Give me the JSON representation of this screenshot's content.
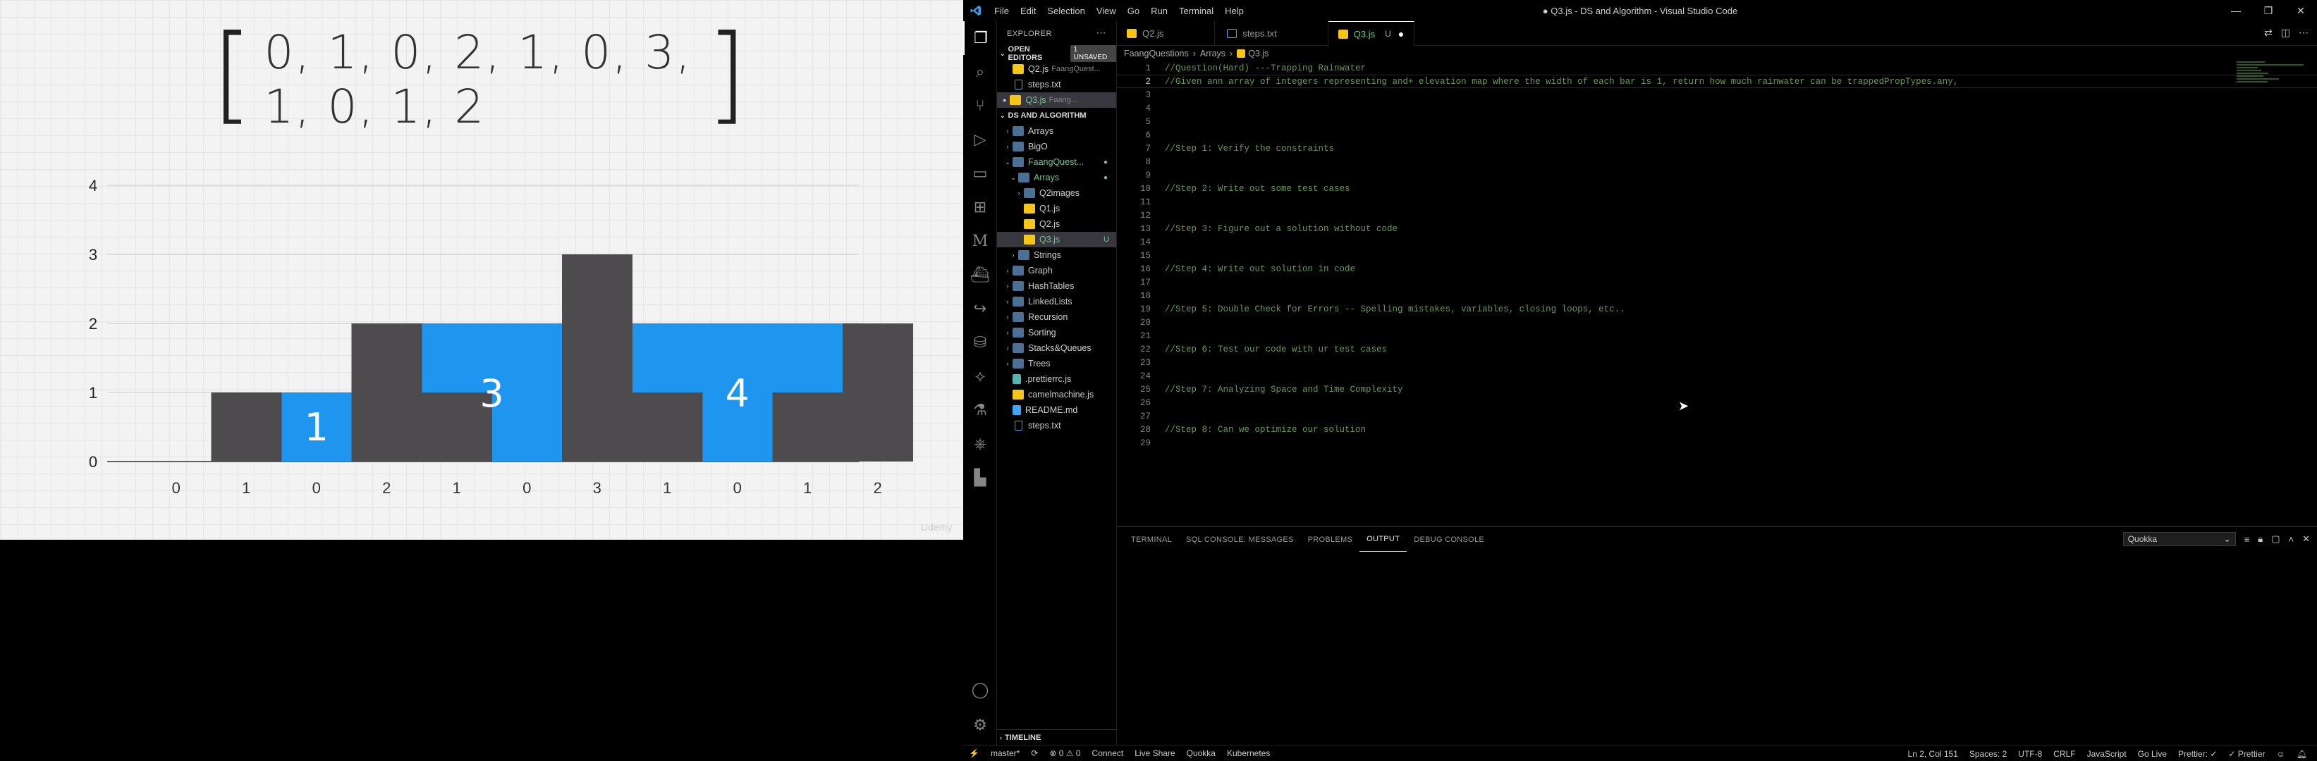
{
  "slide": {
    "bracket_left": "[",
    "bracket_right": "]",
    "array_text": "0, 1, 0, 2, 1, 0, 3, 1, 0, 1, 2",
    "watermark": "Udemy"
  },
  "chart_data": {
    "type": "bar",
    "categories": [
      "0",
      "1",
      "0",
      "2",
      "1",
      "0",
      "3",
      "1",
      "0",
      "1",
      "2"
    ],
    "series": [
      {
        "values": [
          0,
          1,
          0,
          2,
          1,
          0,
          3,
          1,
          0,
          1,
          2
        ]
      }
    ],
    "water": [
      0,
      0,
      1,
      0,
      1,
      2,
      0,
      1,
      2,
      1,
      0
    ],
    "annotations": [
      {
        "text": "1",
        "category_index": 2
      },
      {
        "text": "3",
        "category_index": 4.5
      },
      {
        "text": "4",
        "category_index": 8
      }
    ],
    "yticks": [
      "0",
      "1",
      "2",
      "3",
      "4"
    ],
    "ylim": [
      0,
      4
    ],
    "grid": true,
    "colors": {
      "bar": "#4d4b4e",
      "water": "#1e96f0"
    }
  },
  "vscode": {
    "title": "● Q3.js - DS and Algorithm - Visual Studio Code",
    "menu": [
      "File",
      "Edit",
      "Selection",
      "View",
      "Go",
      "Run",
      "Terminal",
      "Help"
    ],
    "window_controls": [
      "—",
      "❐",
      "✕"
    ],
    "explorer_title": "EXPLORER",
    "open_editors_label": "OPEN EDITORS",
    "unsaved_badge": "1 UNSAVED",
    "open_editors": [
      {
        "name": "Q2.js",
        "hint": "FaangQuest...",
        "icon": "js"
      },
      {
        "name": "steps.txt",
        "hint": "",
        "icon": "txt"
      },
      {
        "name": "Q3.js",
        "hint": "Faang...",
        "icon": "js",
        "badge": "U",
        "modified": "●"
      }
    ],
    "workspace_label": "DS AND ALGORITHM",
    "tree": [
      {
        "name": "Arrays",
        "type": "folder",
        "indent": 1,
        "chev": "›"
      },
      {
        "name": "BigO",
        "type": "folder",
        "indent": 1,
        "chev": "›"
      },
      {
        "name": "FaangQuest...",
        "type": "folder",
        "indent": 1,
        "chev": "⌄",
        "green": true,
        "dot": "●"
      },
      {
        "name": "Arrays",
        "type": "folder",
        "indent": 2,
        "chev": "⌄",
        "green": true,
        "dot": "●"
      },
      {
        "name": "Q2images",
        "type": "folder",
        "indent": 3,
        "chev": "›"
      },
      {
        "name": "Q1.js",
        "type": "js",
        "indent": 3,
        "chev": ""
      },
      {
        "name": "Q2.js",
        "type": "js",
        "indent": 3,
        "chev": ""
      },
      {
        "name": "Q3.js",
        "type": "js",
        "indent": 3,
        "chev": "",
        "green": true,
        "mod": "U",
        "selected": true
      },
      {
        "name": "Strings",
        "type": "folder",
        "indent": 2,
        "chev": "›"
      },
      {
        "name": "Graph",
        "type": "folder",
        "indent": 1,
        "chev": "›"
      },
      {
        "name": "HashTables",
        "type": "folder",
        "indent": 1,
        "chev": "›"
      },
      {
        "name": "LinkedLists",
        "type": "folder",
        "indent": 1,
        "chev": "›"
      },
      {
        "name": "Recursion",
        "type": "folder",
        "indent": 1,
        "chev": "›"
      },
      {
        "name": "Sorting",
        "type": "folder",
        "indent": 1,
        "chev": "›"
      },
      {
        "name": "Stacks&Queues",
        "type": "folder",
        "indent": 1,
        "chev": "›"
      },
      {
        "name": "Trees",
        "type": "folder",
        "indent": 1,
        "chev": "›"
      },
      {
        "name": ".prettierrc.js",
        "type": "prettier",
        "indent": 1,
        "chev": ""
      },
      {
        "name": "camelmachine.js",
        "type": "js",
        "indent": 1,
        "chev": ""
      },
      {
        "name": "README.md",
        "type": "md",
        "indent": 1,
        "chev": ""
      },
      {
        "name": "steps.txt",
        "type": "txt",
        "indent": 1,
        "chev": ""
      }
    ],
    "timeline_label": "TIMELINE",
    "tabs": [
      {
        "name": "Q2.js",
        "icon": "js",
        "active": false
      },
      {
        "name": "steps.txt",
        "icon": "txt",
        "active": false
      },
      {
        "name": "Q3.js",
        "icon": "js",
        "active": true,
        "badge": "U",
        "dirty": "●"
      }
    ],
    "breadcrumb": [
      "FaangQuestions",
      "›",
      "Arrays",
      "›",
      "Q3.js"
    ],
    "code_lines": [
      "//Question(Hard) ---Trapping Rainwater",
      "//Given ann array of integers representing and+ elevation map where the width of each bar is 1, return how much rainwater can be trappedPropTypes.any,",
      "",
      "",
      "",
      "",
      "//Step 1: Verify the constraints",
      "",
      "",
      "//Step 2: Write out some test cases",
      "",
      "",
      "//Step 3: Figure out a solution without code",
      "",
      "",
      "//Step 4: Write out solution in code",
      "",
      "",
      "//Step 5: Double Check for Errors -- Spelling mistakes, variables, closing loops, etc..",
      "",
      "",
      "//Step 6: Test our code with ur test cases",
      "",
      "",
      "//Step 7: Analyzing Space and Time Complexity",
      "",
      "",
      "//Step 8: Can we optimize our solution",
      ""
    ],
    "current_line": 2,
    "panel_tabs": [
      "TERMINAL",
      "SQL CONSOLE: MESSAGES",
      "PROBLEMS",
      "OUTPUT",
      "DEBUG CONSOLE"
    ],
    "panel_active": "OUTPUT",
    "output_channel": "Quokka",
    "status_left": [
      "⚡",
      "master*",
      "⟳",
      "⊗ 0 ⚠ 0",
      "Connect",
      "Live Share",
      "Quokka",
      "Kubernetes"
    ],
    "status_right": [
      "Ln 2, Col 151",
      "Spaces: 2",
      "UTF-8",
      "CRLF",
      "JavaScript",
      "Go Live",
      "Prettier: ✓",
      "✓ Prettier"
    ]
  }
}
